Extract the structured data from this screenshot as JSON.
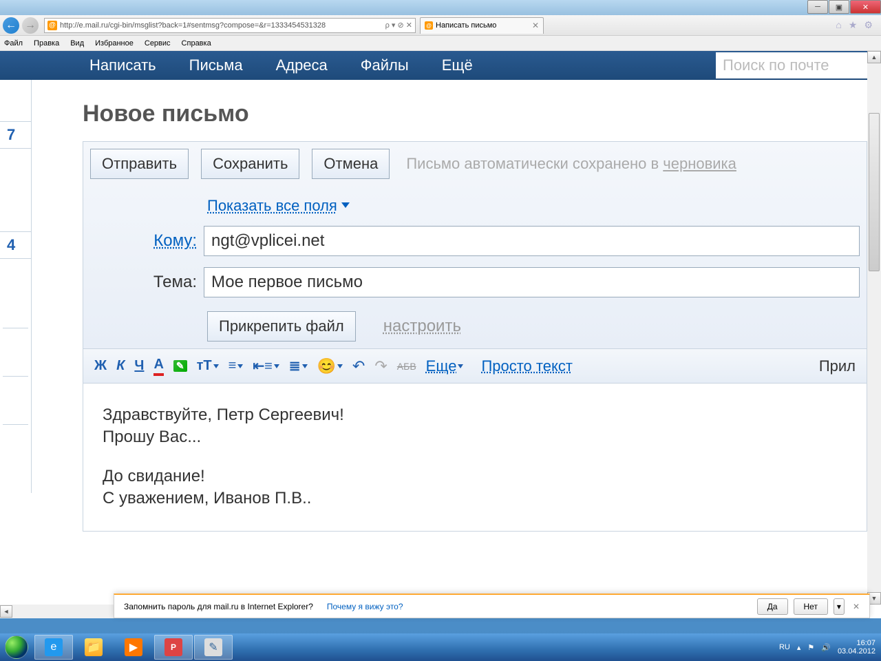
{
  "window": {
    "title": "Написать письмо"
  },
  "browser": {
    "url": "http://e.mail.ru/cgi-bin/msglist?back=1#sentmsg?compose=&r=1333454531328",
    "tab_title": "Написать письмо",
    "search_controls": "ρ ▾ ⊘ ✕"
  },
  "menubar": {
    "file": "Файл",
    "edit": "Правка",
    "view": "Вид",
    "favorites": "Избранное",
    "service": "Сервис",
    "help": "Справка"
  },
  "mailnav": {
    "compose": "Написать",
    "letters": "Письма",
    "addr": "Адреса",
    "files": "Файлы",
    "more": "Ещё",
    "search_placeholder": "Поиск по почте"
  },
  "left": {
    "n7": "7",
    "n4": "4"
  },
  "page": {
    "title": "Новое письмо",
    "send": "Отправить",
    "save": "Сохранить",
    "cancel": "Отмена",
    "autosave_prefix": "Письмо автоматически сохранено в ",
    "autosave_link": "черновика",
    "show_fields": "Показать все поля",
    "to_label": "Кому:",
    "to_value": "ngt@vplicei.net",
    "subject_label": "Тема:",
    "subject_value": "Мое первое письмо",
    "attach": "Прикрепить файл",
    "configure": "настроить"
  },
  "toolbar": {
    "bold": "Ж",
    "italic": "К",
    "under": "Ч",
    "more": "Еще",
    "plain": "Просто текст",
    "right": "Прил",
    "strike": "АБВ"
  },
  "body": {
    "l1": "Здравствуйте, Петр Сергеевич!",
    "l2": "Прошу Вас...",
    "l3": "До свидание!",
    "l4": "С уважением, Иванов П.В.."
  },
  "notif": {
    "text": "Запомнить пароль для mail.ru в Internet Explorer?",
    "why": "Почему я вижу это?",
    "yes": "Да",
    "no": "Нет"
  },
  "tray": {
    "lang": "RU",
    "time": "16:07",
    "date": "03.04.2012"
  },
  "ppt": {
    "label": "P"
  }
}
